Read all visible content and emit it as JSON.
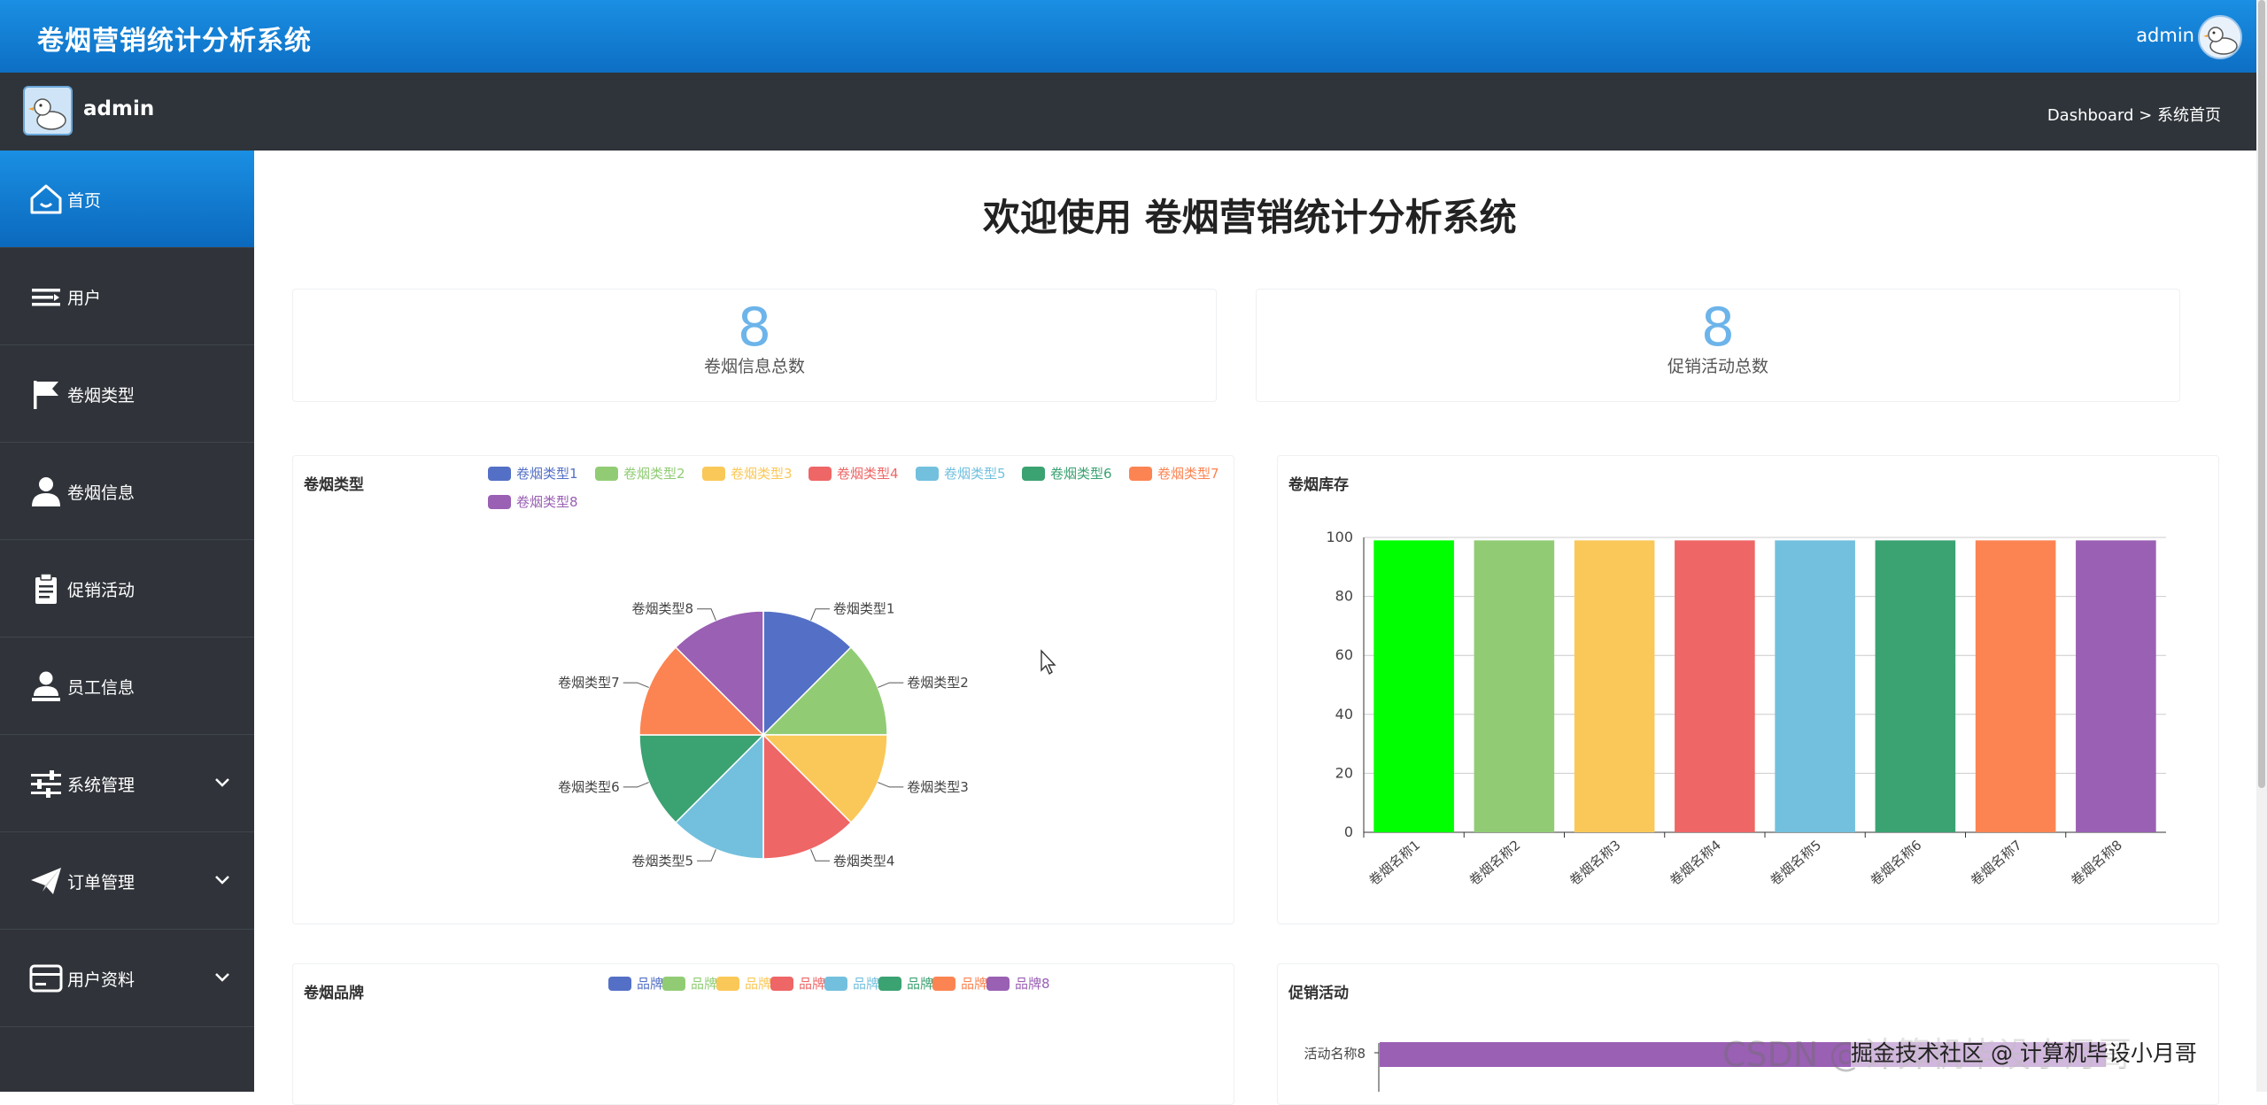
{
  "app": {
    "title": "卷烟营销统计分析系统",
    "user": "admin"
  },
  "subheader": {
    "user": "admin",
    "breadcrumb": "Dashboard > 系统首页"
  },
  "sidebar": {
    "items": [
      {
        "label": "首页",
        "icon": "home-icon",
        "active": true
      },
      {
        "label": "用户",
        "icon": "user-list-icon"
      },
      {
        "label": "卷烟类型",
        "icon": "flag-icon"
      },
      {
        "label": "卷烟信息",
        "icon": "person-icon"
      },
      {
        "label": "促销活动",
        "icon": "clipboard-icon"
      },
      {
        "label": "员工信息",
        "icon": "employee-icon"
      },
      {
        "label": "系统管理",
        "icon": "sliders-icon",
        "expandable": true
      },
      {
        "label": "订单管理",
        "icon": "send-icon",
        "expandable": true
      },
      {
        "label": "用户资料",
        "icon": "card-icon",
        "expandable": true
      }
    ]
  },
  "main": {
    "welcome": "欢迎使用 卷烟营销统计分析系统",
    "stats": [
      {
        "value": "8",
        "label": "卷烟信息总数"
      },
      {
        "value": "8",
        "label": "促销活动总数"
      }
    ],
    "panels": {
      "type_title": "卷烟类型",
      "stock_title": "卷烟库存",
      "brand_title": "卷烟品牌",
      "promo_title": "促销活动"
    }
  },
  "colors": [
    "#5470c6",
    "#91cc75",
    "#fac858",
    "#ee6666",
    "#73c0de",
    "#3ba272",
    "#fc8452",
    "#9a60b4"
  ],
  "chart_data": [
    {
      "type": "pie",
      "title": "卷烟类型",
      "legend": [
        "卷烟类型1",
        "卷烟类型2",
        "卷烟类型3",
        "卷烟类型4",
        "卷烟类型5",
        "卷烟类型6",
        "卷烟类型7",
        "卷烟类型8"
      ],
      "values": [
        1,
        1,
        1,
        1,
        1,
        1,
        1,
        1
      ]
    },
    {
      "type": "bar",
      "title": "卷烟库存",
      "categories": [
        "卷烟名称1",
        "卷烟名称2",
        "卷烟名称3",
        "卷烟名称4",
        "卷烟名称5",
        "卷烟名称6",
        "卷烟名称7",
        "卷烟名称8"
      ],
      "values": [
        99,
        99,
        99,
        99,
        99,
        99,
        99,
        99
      ],
      "ylim": [
        0,
        100
      ],
      "yticks": [
        0,
        20,
        40,
        60,
        80,
        100
      ],
      "colors": [
        "#00ff00",
        "#91cc75",
        "#fac858",
        "#ee6666",
        "#73c0de",
        "#3ba272",
        "#fc8452",
        "#9a60b4"
      ]
    },
    {
      "type": "pie",
      "title": "卷烟品牌",
      "legend": [
        "品牌1",
        "品牌2",
        "品牌3",
        "品牌4",
        "品牌5",
        "品牌6",
        "品牌7",
        "品牌8"
      ]
    },
    {
      "type": "bar",
      "title": "促销活动",
      "categories": [
        "活动名称8"
      ],
      "colors": [
        "#9a60b4"
      ]
    }
  ],
  "watermark": "CSDN @计算机毕设小月哥",
  "watermark2": "掘金技术社区 @ 计算机毕设小月哥"
}
